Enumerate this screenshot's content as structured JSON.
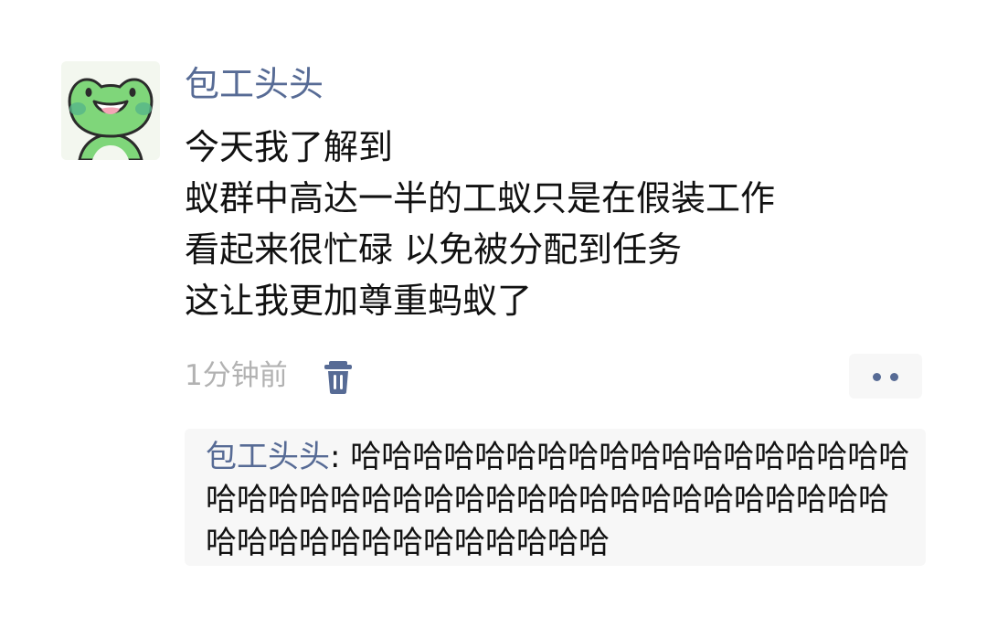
{
  "post": {
    "author": "包工头头",
    "lines": [
      "今天我了解到",
      "蚁群中高达一半的工蚁只是在假装工作",
      "看起来很忙碌 以免被分配到任务",
      "这让我更加尊重蚂蚁了"
    ],
    "time": "1分钟前",
    "delete_icon": "trash-icon",
    "more_icon": "two-dots-icon"
  },
  "comments": [
    {
      "author": "包工头头",
      "separator": ": ",
      "text": "哈哈哈哈哈哈哈哈哈哈哈哈哈哈哈哈哈哈哈哈哈哈哈哈哈哈哈哈哈哈哈哈哈哈哈哈哈哈哈哈哈哈哈哈哈哈哈哈哈哈哈哈哈"
    }
  ],
  "colors": {
    "link": "#576b95",
    "text": "#111111",
    "muted": "#b2b2b2",
    "comment_bg": "#f7f7f7",
    "avatar_green": "#7fd67a"
  }
}
